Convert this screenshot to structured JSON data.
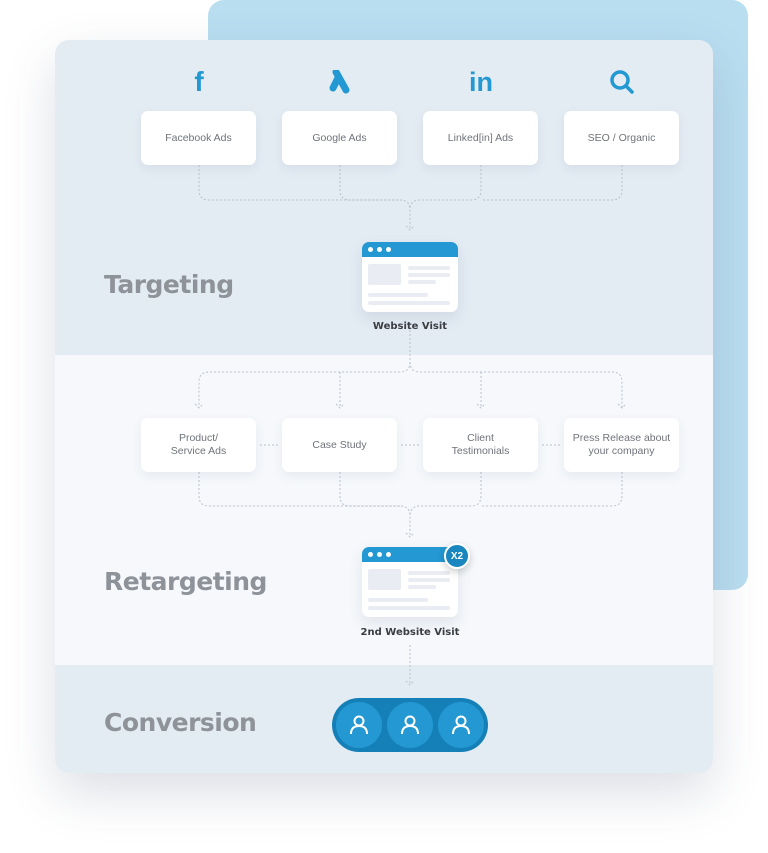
{
  "sections": {
    "targeting": "Targeting",
    "retargeting": "Retargeting",
    "conversion": "Conversion"
  },
  "sources": [
    {
      "label": "Facebook Ads",
      "icon": "facebook-icon",
      "glyph": "f"
    },
    {
      "label": "Google Ads",
      "icon": "google-ads-icon",
      "glyph": ""
    },
    {
      "label": "Linked[in] Ads",
      "icon": "linkedin-icon",
      "glyph": "in"
    },
    {
      "label": "SEO / Organic",
      "icon": "search-icon",
      "glyph": ""
    }
  ],
  "website_visit": "Website Visit",
  "retargeting_items": [
    "Product/\nService Ads",
    "Case Study",
    "Client\nTestimonials",
    "Press Release about\nyour company"
  ],
  "second_visit": "2nd Website Visit",
  "badge": "X2",
  "colors": {
    "accent": "#2498d2",
    "section_bg": "#e3ebf3",
    "back_card": "#b9def0",
    "title": "#8e9299"
  }
}
